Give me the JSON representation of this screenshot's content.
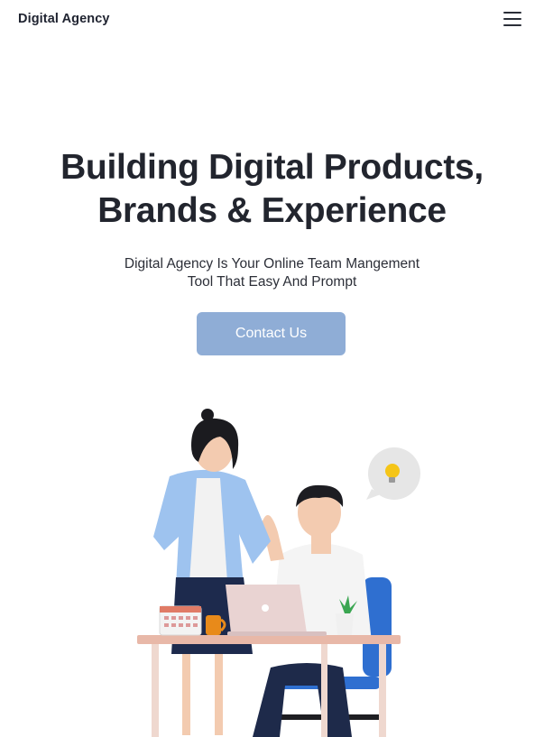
{
  "header": {
    "brand": "Digital Agency",
    "menu_icon": "hamburger-menu-icon"
  },
  "hero": {
    "title_line1": "Building Digital Products,",
    "title_line2": "Brands & Experience",
    "subtitle_line1": "Digital Agency Is Your Online Team Mangement",
    "subtitle_line2": "Tool That Easy And Prompt",
    "cta_label": "Contact Us"
  },
  "colors": {
    "cta_bg": "#8fadd6",
    "text": "#22252e"
  }
}
